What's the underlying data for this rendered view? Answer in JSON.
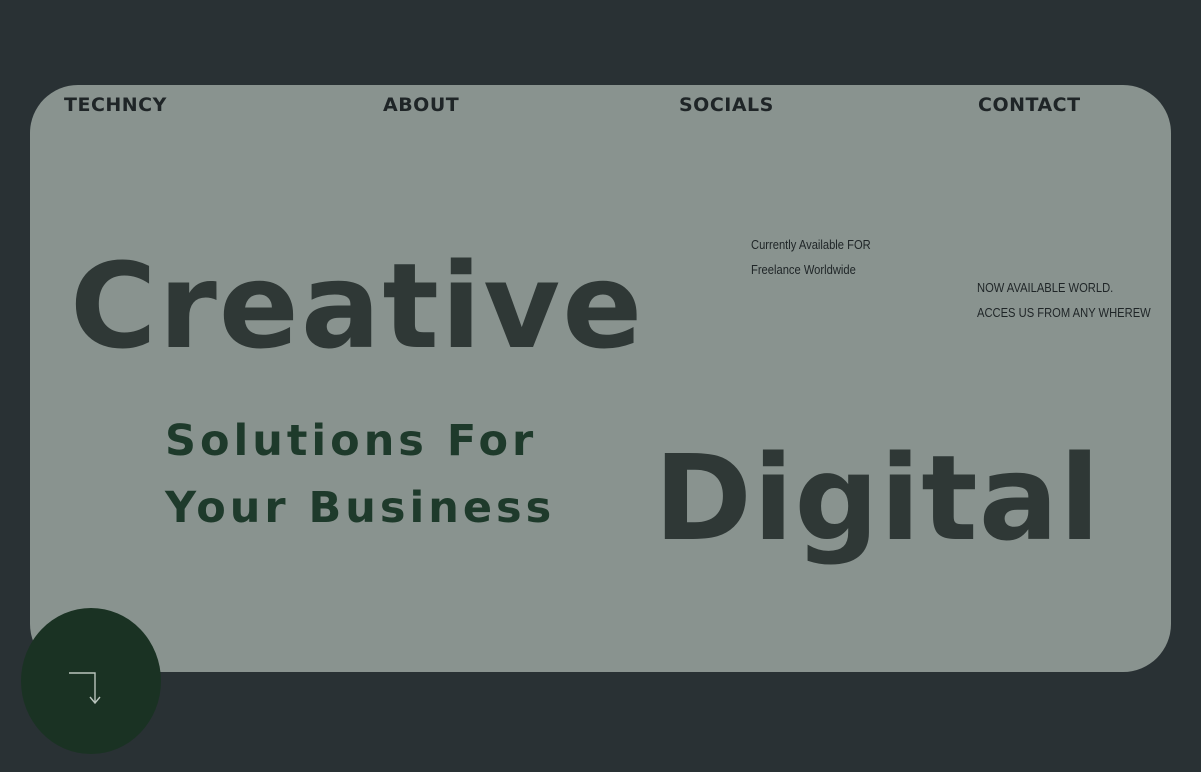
{
  "nav": {
    "brand": "TECHNCY",
    "about": "ABOUT",
    "socials": "SOCIALS",
    "contact": "CONTACT"
  },
  "hero": {
    "word_1": "Creative",
    "subtitle_line_1": "Solutions For",
    "subtitle_line_2": "Your Business",
    "word_2": "Digital"
  },
  "notes": {
    "availability_line_1": "Currently Available FOR",
    "availability_line_2": "Freelance Worldwide",
    "worldwide_line_1": "NOW AVAILABLE WORLD.",
    "worldwide_line_2": "ACCES US FROM ANY WHEREW"
  },
  "scroll_button": {
    "icon": "arrow-down-right-corner-icon"
  },
  "colors": {
    "page_background": "#293134",
    "panel_background": "#89938f",
    "headline": "#2f3836",
    "subtitle": "#1e3a2b",
    "button": "#1a3223"
  }
}
